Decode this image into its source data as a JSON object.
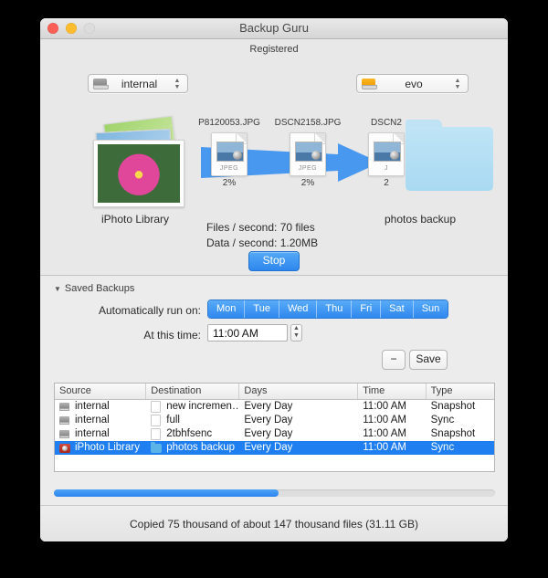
{
  "window": {
    "title": "Backup Guru",
    "registered_label": "Registered",
    "traffic_lights": [
      "close-button",
      "minimize-button",
      "zoom-button"
    ]
  },
  "transfer": {
    "source_popup": {
      "value": "internal",
      "icon": "hard-drive-icon"
    },
    "dest_popup": {
      "value": "evo",
      "icon": "external-drive-icon"
    },
    "source_caption": "iPhoto Library",
    "dest_caption": "photos backup",
    "files": [
      {
        "name": "P8120053.JPG",
        "kind": "JPEG",
        "percent": "2%"
      },
      {
        "name": "DSCN2158.JPG",
        "kind": "JPEG",
        "percent": "2%"
      },
      {
        "name": "DSCN2",
        "kind": "J",
        "percent": "2"
      }
    ],
    "files_per_second": "Files / second: 70 files",
    "data_per_second": "Data / second: 1.20MB",
    "stop_label": "Stop"
  },
  "saved_backups": {
    "section_label": "Saved Backups",
    "run_on_label": "Automatically run on:",
    "days": [
      "Mon",
      "Tue",
      "Wed",
      "Thu",
      "Fri",
      "Sat",
      "Sun"
    ],
    "time_label": "At this time:",
    "time_value": "11:00 AM",
    "remove_label": "−",
    "save_label": "Save"
  },
  "table": {
    "headers": [
      "Source",
      "Destination",
      "Days",
      "Time",
      "Type"
    ],
    "rows": [
      {
        "source": "internal",
        "source_icon": "hard-drive-icon",
        "destination": "new incremen…",
        "dest_icon": "document-icon",
        "days": "Every Day",
        "time": "11:00 AM",
        "type": "Snapshot",
        "selected": false
      },
      {
        "source": "internal",
        "source_icon": "hard-drive-icon",
        "destination": "full",
        "dest_icon": "document-icon",
        "days": "Every Day",
        "time": "11:00 AM",
        "type": "Sync",
        "selected": false
      },
      {
        "source": "internal",
        "source_icon": "hard-drive-icon",
        "destination": "2tbhfsenc",
        "dest_icon": "document-icon",
        "days": "Every Day",
        "time": "11:00 AM",
        "type": "Snapshot",
        "selected": false
      },
      {
        "source": "iPhoto Library",
        "source_icon": "iphoto-icon",
        "destination": "photos backup",
        "dest_icon": "folder-icon",
        "days": "Every Day",
        "time": "11:00 AM",
        "type": "Sync",
        "selected": true
      }
    ]
  },
  "progress": {
    "percent": 51,
    "status_text": "Copied 75 thousand of about 147 thousand files (31.11 GB)"
  },
  "colors": {
    "accent_blue": "#2f88ef",
    "selection_blue": "#1f7ef0",
    "window_bg": "#ececec",
    "folder_blue": "#bfe4f6",
    "drive_orange": "#fcb81e"
  }
}
